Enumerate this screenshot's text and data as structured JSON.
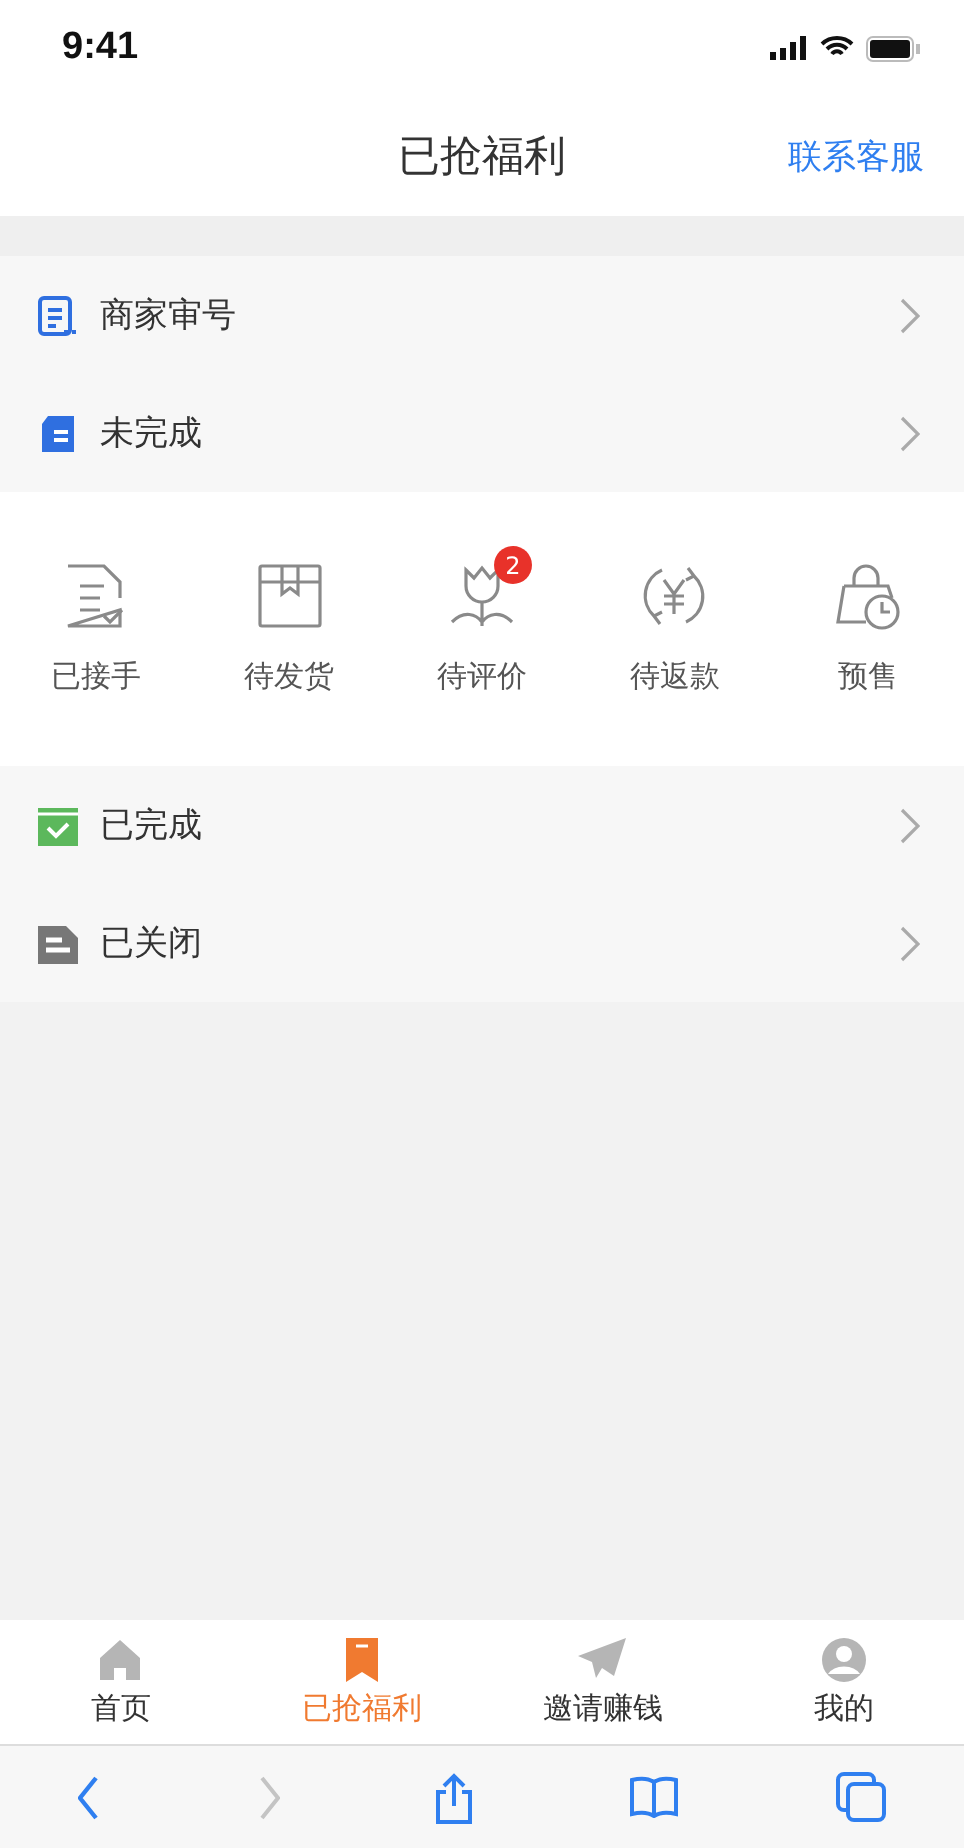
{
  "status_bar": {
    "time": "9:41"
  },
  "nav": {
    "title": "已抢福利",
    "action": "联系客服"
  },
  "top_rows": [
    {
      "kind": "review",
      "label": "商家审号"
    },
    {
      "kind": "pending",
      "label": "未完成"
    }
  ],
  "order_states": [
    {
      "kind": "accepted",
      "label": "已接手"
    },
    {
      "kind": "ship",
      "label": "待发货"
    },
    {
      "kind": "rate",
      "label": "待评价",
      "badge": "2"
    },
    {
      "kind": "refund",
      "label": "待返款"
    },
    {
      "kind": "presale",
      "label": "预售"
    }
  ],
  "bottom_rows": [
    {
      "kind": "done",
      "label": "已完成"
    },
    {
      "kind": "closed",
      "label": "已关闭"
    }
  ],
  "tab_bar": [
    {
      "kind": "home",
      "label": "首页",
      "selected": false
    },
    {
      "kind": "bookmark",
      "label": "已抢福利",
      "selected": true
    },
    {
      "kind": "plane",
      "label": "邀请赚钱",
      "selected": false
    },
    {
      "kind": "person",
      "label": "我的",
      "selected": false
    }
  ],
  "browser_toolbar": [
    {
      "kind": "back",
      "disabled": false
    },
    {
      "kind": "forward",
      "disabled": true
    },
    {
      "kind": "share",
      "disabled": false
    },
    {
      "kind": "book",
      "disabled": false
    },
    {
      "kind": "tabs",
      "disabled": false
    }
  ]
}
